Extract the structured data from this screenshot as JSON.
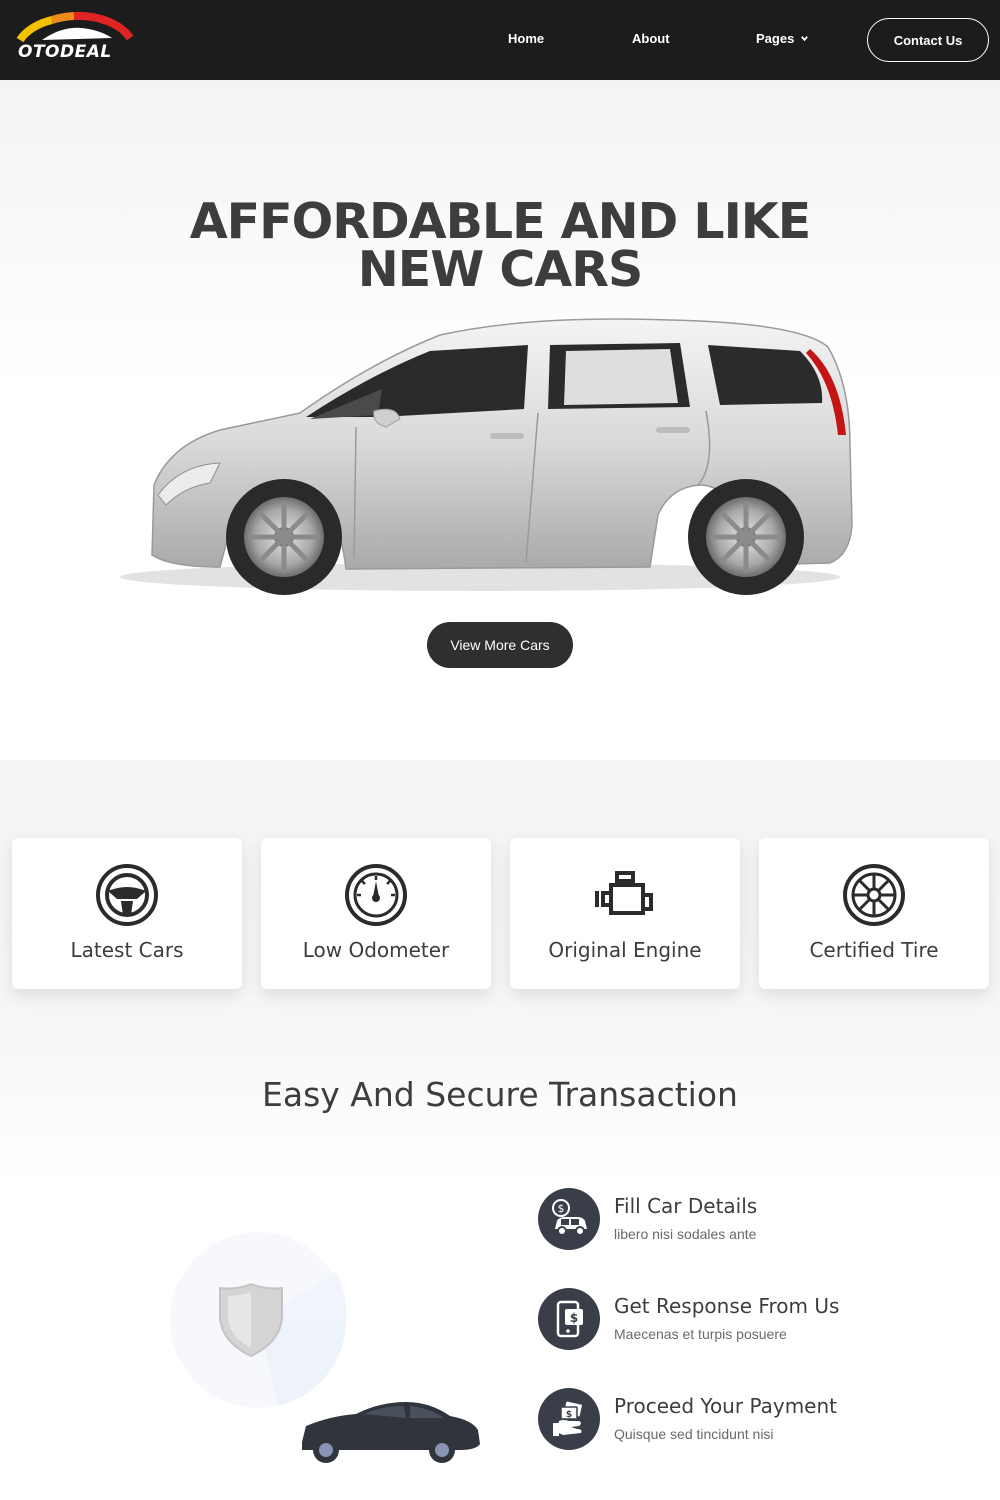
{
  "header": {
    "logo_text": "OTODEAL",
    "nav": {
      "home": "Home",
      "about": "About",
      "pages": "Pages",
      "contact": "Contact Us"
    }
  },
  "hero": {
    "title_line1": "AFFORDABLE AND LIKE",
    "title_line2": "NEW CARS",
    "cta": "View More Cars"
  },
  "features": {
    "items": [
      {
        "label": "Latest Cars",
        "icon": "steering-wheel-icon"
      },
      {
        "label": "Low Odometer",
        "icon": "speedometer-icon"
      },
      {
        "label": "Original Engine",
        "icon": "engine-icon"
      },
      {
        "label": "Certified Tire",
        "icon": "tire-icon"
      }
    ]
  },
  "transaction": {
    "title": "Easy And Secure Transaction",
    "steps": [
      {
        "title": "Fill Car Details",
        "desc": "libero nisi sodales ante",
        "icon": "car-money-icon"
      },
      {
        "title": "Get Response From Us",
        "desc": "Maecenas et turpis posuere",
        "icon": "phone-dollar-icon"
      },
      {
        "title": "Proceed Your Payment",
        "desc": "Quisque sed tincidunt nisi",
        "icon": "cash-hand-icon"
      }
    ]
  },
  "colors": {
    "header_bg": "#1c1c1c",
    "button_dark": "#2f2f2f",
    "step_icon_bg": "#3a3e48",
    "logo_red": "#e02424"
  }
}
